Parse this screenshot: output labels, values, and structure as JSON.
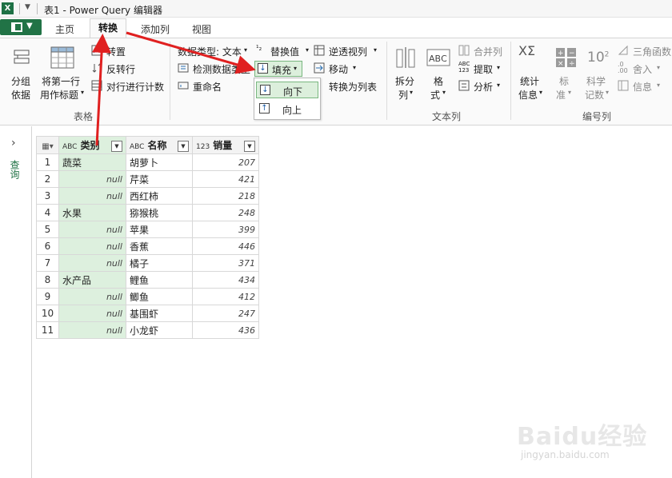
{
  "title_bar": {
    "app_icon_label": "X",
    "window_title": "表1 - Power Query 编辑器"
  },
  "tabs": [
    "主页",
    "转换",
    "添加列",
    "视图"
  ],
  "active_tab": "转换",
  "ribbon": {
    "group_by": [
      "分组",
      "依据"
    ],
    "first_row_header": [
      "将第一行",
      "用作标题"
    ],
    "transpose": "转置",
    "reverse_rows": "反转行",
    "count_rows": "对行进行计数",
    "table_group_label": "表格",
    "data_type": "数据类型: 文本",
    "detect_type": "检测数据类型",
    "rename": "重命名",
    "replace_values": "替换值",
    "fill": "填充",
    "unpivot": "逆透视列",
    "move": "移动",
    "to_list": "转换为列表",
    "split_column": [
      "拆分",
      "列"
    ],
    "format": [
      "格",
      "式"
    ],
    "merge_columns": "合并列",
    "extract": "提取",
    "parse": "分析",
    "text_group_label": "文本列",
    "statistics": [
      "统计",
      "信息"
    ],
    "standard": [
      "标",
      "准"
    ],
    "scientific": [
      "科学",
      "记数"
    ],
    "trig": "三角函数",
    "rounding": "舍入",
    "information": "信息",
    "number_group_label": "编号列"
  },
  "fill_menu": {
    "down": "向下",
    "up": "向上"
  },
  "left_pane": {
    "label": "查询"
  },
  "table": {
    "headers": [
      {
        "type": "ABC",
        "name": "类别"
      },
      {
        "type": "ABC",
        "name": "名称"
      },
      {
        "type": "123",
        "name": "销量"
      }
    ],
    "rows": [
      {
        "n": "1",
        "cat": "蔬菜",
        "name": "胡萝卜",
        "sales": "207"
      },
      {
        "n": "2",
        "cat": "null",
        "name": "芹菜",
        "sales": "421"
      },
      {
        "n": "3",
        "cat": "null",
        "name": "西红柿",
        "sales": "218"
      },
      {
        "n": "4",
        "cat": "水果",
        "name": "猕猴桃",
        "sales": "248"
      },
      {
        "n": "5",
        "cat": "null",
        "name": "苹果",
        "sales": "399"
      },
      {
        "n": "6",
        "cat": "null",
        "name": "香蕉",
        "sales": "446"
      },
      {
        "n": "7",
        "cat": "null",
        "name": "橘子",
        "sales": "371"
      },
      {
        "n": "8",
        "cat": "水产品",
        "name": "鲤鱼",
        "sales": "434"
      },
      {
        "n": "9",
        "cat": "null",
        "name": "鲫鱼",
        "sales": "412"
      },
      {
        "n": "10",
        "cat": "null",
        "name": "基围虾",
        "sales": "247"
      },
      {
        "n": "11",
        "cat": "null",
        "name": "小龙虾",
        "sales": "436"
      }
    ]
  },
  "watermark": {
    "brand": "Baidu经验",
    "url": "jingyan.baidu.com"
  },
  "colors": {
    "excel_green": "#217346",
    "selected_fill": "#dcefdc",
    "annotation_red": "#e02020"
  }
}
